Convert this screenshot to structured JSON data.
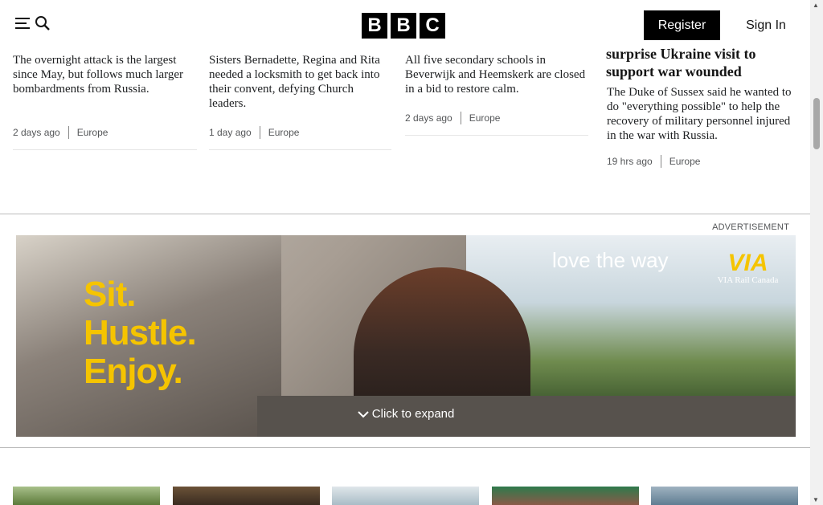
{
  "header": {
    "logo_letters": [
      "B",
      "B",
      "C"
    ],
    "register_label": "Register",
    "signin_label": "Sign In",
    "menu_icon": "hamburger-icon",
    "search_icon": "search-icon"
  },
  "articles": [
    {
      "summary": "The overnight attack is the largest since May, but follows much larger bombardments from Russia.",
      "time": "2 days ago",
      "section": "Europe"
    },
    {
      "summary": "Sisters Bernadette, Regina and Rita needed a locksmith to get back into their convent, defying Church leaders.",
      "time": "1 day ago",
      "section": "Europe"
    },
    {
      "summary": "All five secondary schools in Beverwijk and Heemskerk are closed in a bid to restore calm.",
      "time": "2 days ago",
      "section": "Europe"
    },
    {
      "title": "surprise Ukraine visit to support war wounded",
      "summary": "The Duke of Sussex said he wanted to do \"everything possible\" to help the recovery of military personnel injured in the war with Russia.",
      "time": "19 hrs ago",
      "section": "Europe"
    }
  ],
  "ad": {
    "label": "ADVERTISEMENT",
    "slogan_lines": [
      "Sit.",
      "Hustle.",
      "Enjoy."
    ],
    "tagline": "love the way",
    "brand_mark": "VIA",
    "brand_name": "VIA Rail Canada",
    "expand_label": "Click to expand",
    "accent": "#f5c400"
  }
}
